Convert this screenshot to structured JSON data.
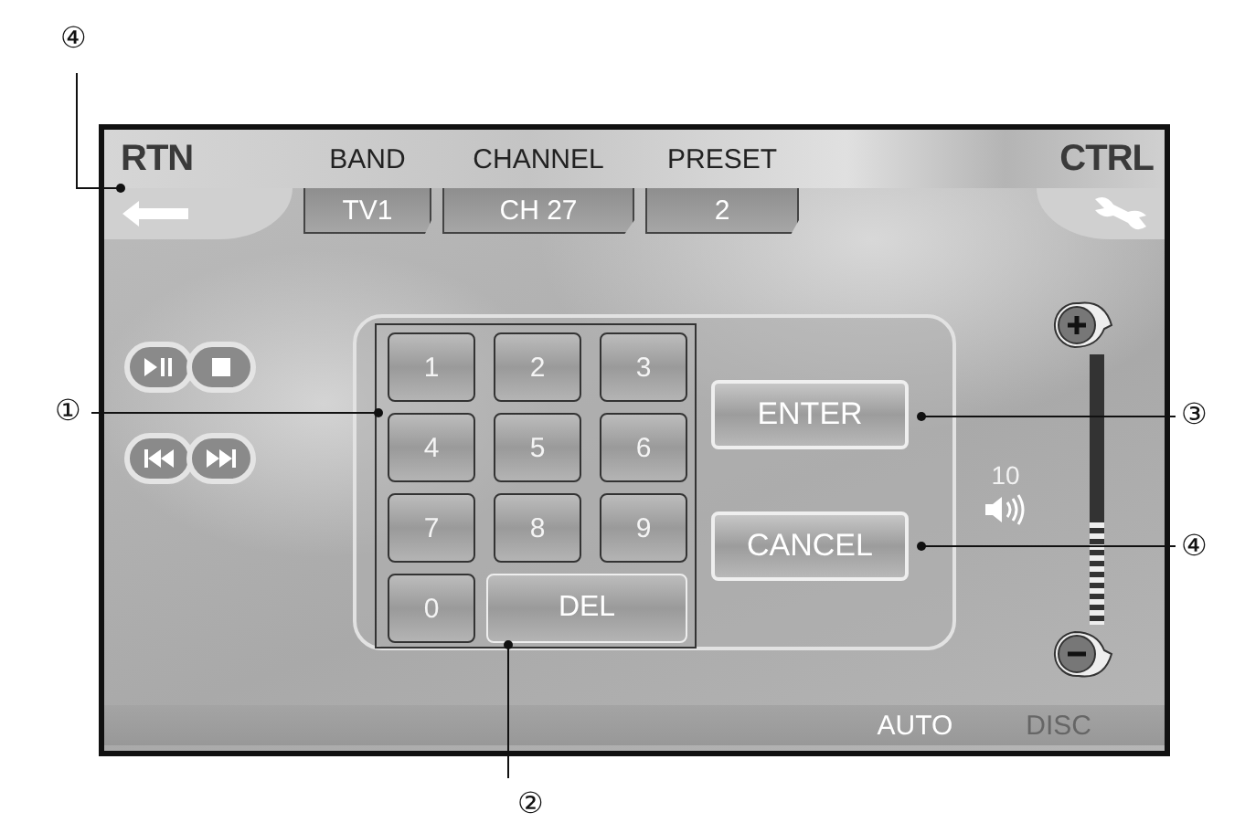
{
  "header": {
    "return_label": "RTN",
    "control_label": "CTRL",
    "fields": [
      {
        "label": "BAND",
        "value": "TV1"
      },
      {
        "label": "CHANNEL",
        "value": "CH 27"
      },
      {
        "label": "PRESET",
        "value": "2"
      }
    ]
  },
  "keypad": {
    "keys": [
      {
        "label": "1",
        "kind": "digit"
      },
      {
        "label": "2",
        "kind": "digit"
      },
      {
        "label": "3",
        "kind": "digit"
      },
      {
        "label": "4",
        "kind": "digit"
      },
      {
        "label": "5",
        "kind": "digit"
      },
      {
        "label": "6",
        "kind": "digit"
      },
      {
        "label": "7",
        "kind": "digit"
      },
      {
        "label": "8",
        "kind": "digit"
      },
      {
        "label": "9",
        "kind": "digit"
      },
      {
        "label": "0",
        "kind": "digit"
      },
      {
        "label": "DEL",
        "kind": "wide"
      }
    ]
  },
  "actions": [
    "ENTER",
    "CANCEL"
  ],
  "volume": {
    "reading": "10",
    "level": 0.4
  },
  "source_bar": [
    {
      "label": "AUTO",
      "selected": true
    },
    {
      "label": "DISC",
      "selected": false
    }
  ],
  "callouts": [
    {
      "number": "④"
    },
    {
      "number": "①"
    },
    {
      "number": "②"
    },
    {
      "number": "③"
    },
    {
      "number": "④"
    }
  ]
}
